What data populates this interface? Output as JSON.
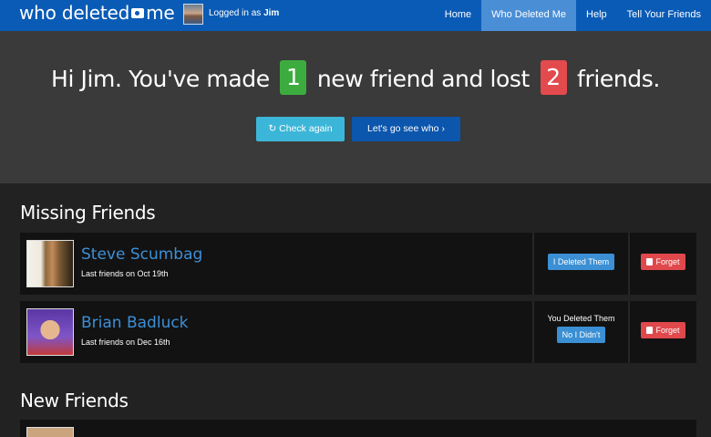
{
  "navbar": {
    "brand_left": "who deleted",
    "brand_right": "me",
    "logged_prefix": "Logged in as",
    "user": "Jim",
    "links": [
      {
        "label": "Home"
      },
      {
        "label": "Who Deleted Me"
      },
      {
        "label": "Help"
      },
      {
        "label": "Tell Your Friends"
      }
    ]
  },
  "hero": {
    "text_1": "Hi Jim. You've made",
    "new_count": "1",
    "text_2": "new friend and lost",
    "lost_count": "2",
    "text_3": "friends.",
    "check_again": "Check again",
    "see_who": "Let's go see who"
  },
  "missing": {
    "title": "Missing Friends",
    "rows": [
      {
        "name": "Steve Scumbag",
        "sub": "Last friends on Oct 19th",
        "status": "",
        "action": "I Deleted Them",
        "forget": "Forget"
      },
      {
        "name": "Brian Badluck",
        "sub": "Last friends on Dec 16th",
        "status": "You Deleted Them",
        "action": "No I Didn't",
        "forget": "Forget"
      }
    ]
  },
  "new_friends": {
    "title": "New Friends"
  },
  "colors": {
    "navbar": "#0a5bb5",
    "active_tab": "#4a8ed6",
    "green_badge": "#3dac3f",
    "red_badge": "#e34a4d",
    "name_link": "#3d8fd6"
  }
}
